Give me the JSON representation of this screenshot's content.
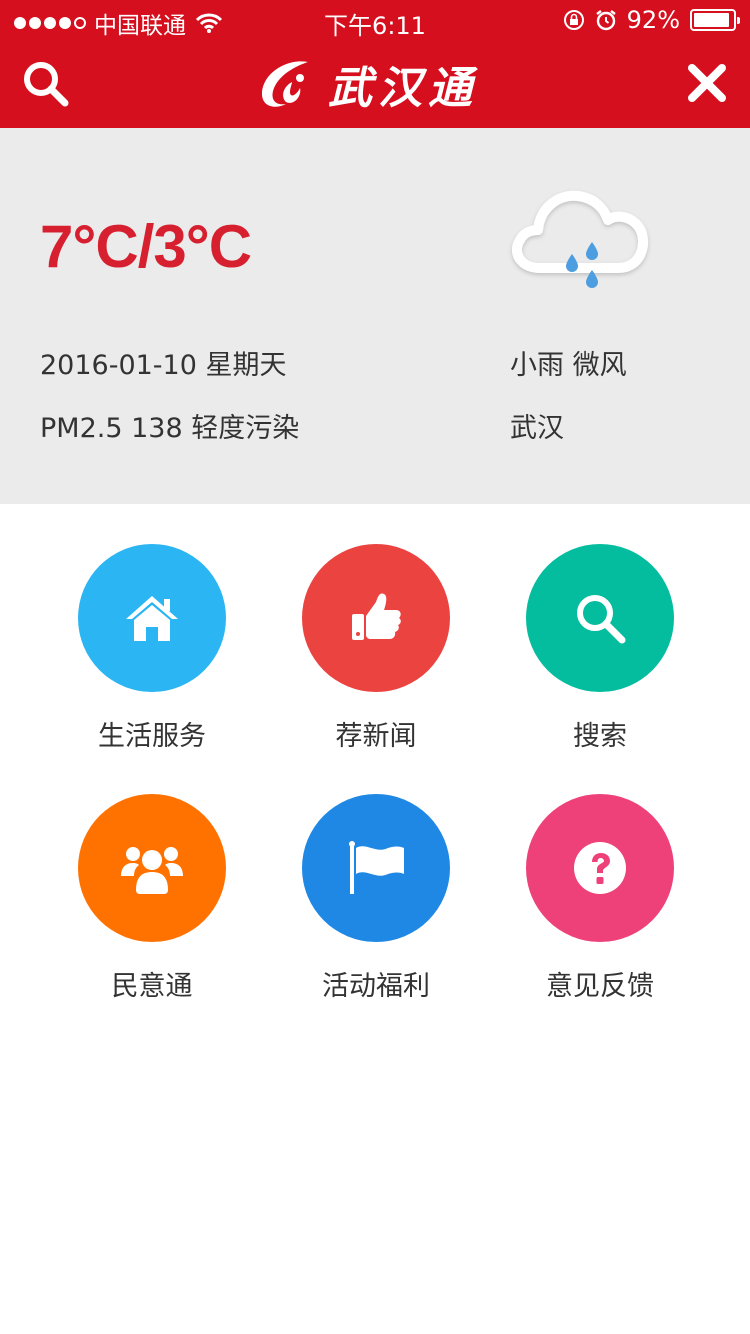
{
  "status_bar": {
    "carrier": "中国联通",
    "time": "下午6:11",
    "battery_percent": "92%",
    "battery_level": 0.92
  },
  "header": {
    "app_name": "武汉通",
    "search_icon": "search-icon",
    "close_icon": "close-icon"
  },
  "weather": {
    "temperature": "7°C/3°C",
    "date": "2016-01-10 星期天",
    "air_quality": "PM2.5 138 轻度污染",
    "condition": "小雨 微风",
    "city": "武汉",
    "icon": "light-rain-icon"
  },
  "menu": [
    {
      "label": "生活服务",
      "icon": "home-icon",
      "color": "#2bb5f3"
    },
    {
      "label": "荐新闻",
      "icon": "thumbs-up-icon",
      "color": "#ea4340"
    },
    {
      "label": "搜索",
      "icon": "search-icon",
      "color": "#04bd9f"
    },
    {
      "label": "民意通",
      "icon": "users-icon",
      "color": "#ff7200"
    },
    {
      "label": "活动福利",
      "icon": "flag-icon",
      "color": "#1f88e5"
    },
    {
      "label": "意见反馈",
      "icon": "question-icon",
      "color": "#ef4179"
    }
  ],
  "colors": {
    "brand_red": "#d50f1e",
    "temperature_red": "#d7202f",
    "weather_bg": "#ebebeb"
  }
}
